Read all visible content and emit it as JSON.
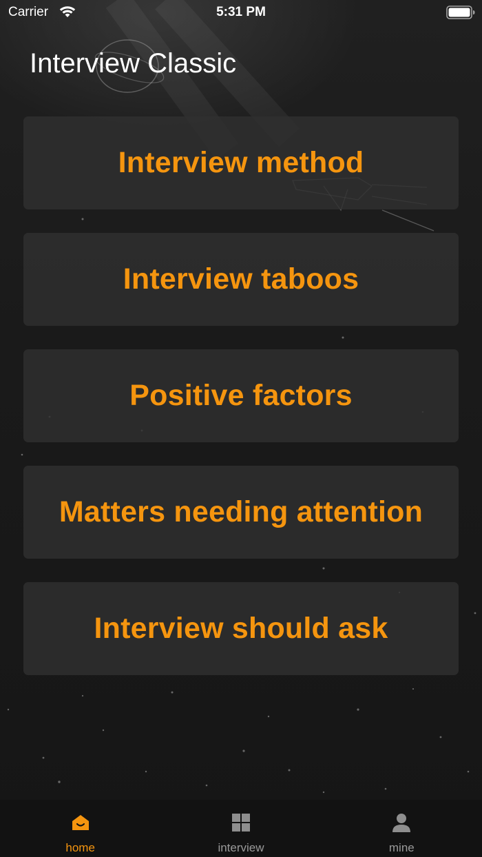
{
  "status_bar": {
    "carrier": "Carrier",
    "time": "5:31 PM",
    "icons": [
      "wifi-icon",
      "battery-icon"
    ]
  },
  "header": {
    "title": "Interview Classic"
  },
  "menu": {
    "items": [
      {
        "label": "Interview method"
      },
      {
        "label": "Interview taboos"
      },
      {
        "label": "Positive factors"
      },
      {
        "label": "Matters needing attention"
      },
      {
        "label": "Interview should ask"
      }
    ]
  },
  "tab_bar": {
    "tabs": [
      {
        "label": "home",
        "icon": "home-icon",
        "active": true
      },
      {
        "label": "interview",
        "icon": "grid-icon",
        "active": false
      },
      {
        "label": "mine",
        "icon": "person-icon",
        "active": false
      }
    ]
  },
  "colors": {
    "accent": "#f5950f",
    "background": "#1b1b1b",
    "card": "#2e2e2e",
    "tab_bar": "#121212",
    "tab_inactive": "#9a9a9a"
  }
}
